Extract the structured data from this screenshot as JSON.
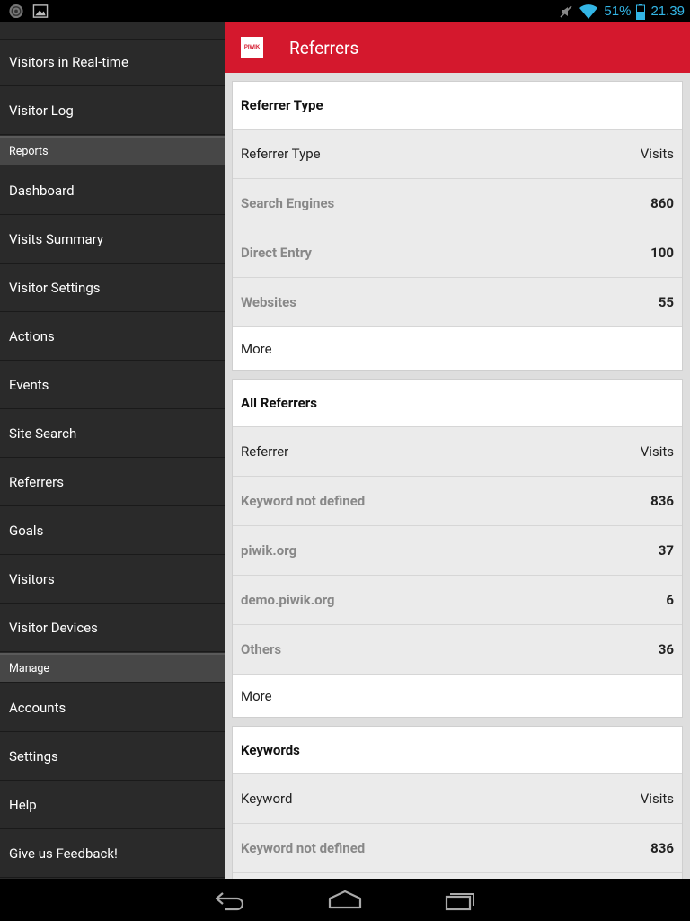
{
  "status_bar": {
    "battery_percent": "51%",
    "time": "21.39",
    "icons": [
      "notification-icon",
      "image-icon",
      "mute-icon",
      "wifi-icon",
      "battery-icon"
    ]
  },
  "sidebar": {
    "items": [
      {
        "type": "item",
        "label": "Visitors in Real-time"
      },
      {
        "type": "item",
        "label": "Visitor Log"
      },
      {
        "type": "section",
        "label": "Reports"
      },
      {
        "type": "item",
        "label": "Dashboard"
      },
      {
        "type": "item",
        "label": "Visits Summary"
      },
      {
        "type": "item",
        "label": "Visitor Settings"
      },
      {
        "type": "item",
        "label": "Actions"
      },
      {
        "type": "item",
        "label": "Events"
      },
      {
        "type": "item",
        "label": "Site Search"
      },
      {
        "type": "item",
        "label": "Referrers"
      },
      {
        "type": "item",
        "label": "Goals"
      },
      {
        "type": "item",
        "label": "Visitors"
      },
      {
        "type": "item",
        "label": "Visitor Devices"
      },
      {
        "type": "section",
        "label": "Manage"
      },
      {
        "type": "item",
        "label": "Accounts"
      },
      {
        "type": "item",
        "label": "Settings"
      },
      {
        "type": "item",
        "label": "Help"
      },
      {
        "type": "item",
        "label": "Give us Feedback!"
      }
    ]
  },
  "action_bar": {
    "logo_text": "PIWIK",
    "title": "Referrers",
    "color": "#d4182d"
  },
  "cards": [
    {
      "title": "Referrer Type",
      "header": {
        "label": "Referrer Type",
        "value": "Visits"
      },
      "rows": [
        {
          "label": "Search Engines",
          "value": "860"
        },
        {
          "label": "Direct Entry",
          "value": "100"
        },
        {
          "label": "Websites",
          "value": "55"
        }
      ],
      "more": "More"
    },
    {
      "title": "All Referrers",
      "header": {
        "label": "Referrer",
        "value": "Visits"
      },
      "rows": [
        {
          "label": "Keyword not defined",
          "value": "836"
        },
        {
          "label": "piwik.org",
          "value": "37"
        },
        {
          "label": "demo.piwik.org",
          "value": "6"
        },
        {
          "label": "Others",
          "value": "36"
        }
      ],
      "more": "More"
    },
    {
      "title": "Keywords",
      "header": {
        "label": "Keyword",
        "value": "Visits"
      },
      "rows": [
        {
          "label": "Keyword not defined",
          "value": "836"
        },
        {
          "label": "",
          "value": ""
        }
      ],
      "more": ""
    }
  ],
  "nav_bar": {
    "buttons": [
      "back-icon",
      "home-icon",
      "recent-apps-icon"
    ]
  }
}
